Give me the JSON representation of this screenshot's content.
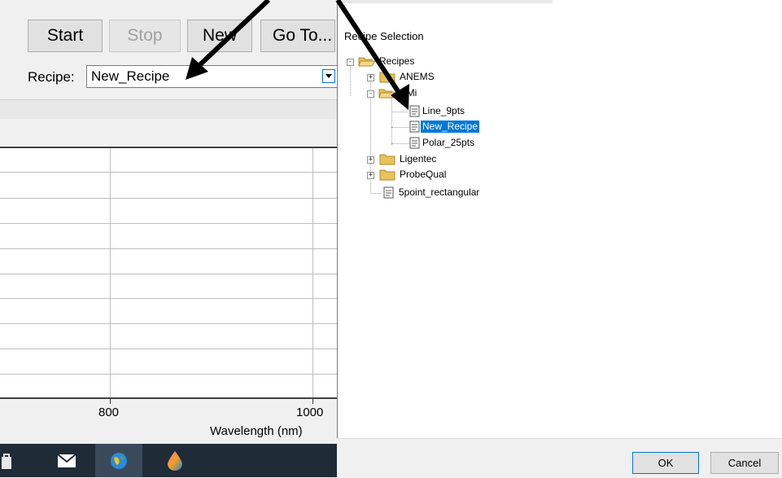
{
  "toolbar": {
    "start_label": "Start",
    "stop_label": "Stop",
    "new_label": "New",
    "goto_label": "Go To..."
  },
  "recipe": {
    "label": "Recipe:",
    "value": "New_Recipe"
  },
  "plot": {
    "x_ticks": [
      "800",
      "1000"
    ],
    "x_label": "Wavelength (nm)"
  },
  "taskbar": {
    "icons": [
      "shopping-bag-icon",
      "mail-icon",
      "globe-app-icon",
      "water-drop-icon"
    ]
  },
  "dialog": {
    "title": "Recipe Selection",
    "tree": {
      "root": "Recipes",
      "items": {
        "anems": "ANEMS",
        "cmi": "CMi",
        "line_9pts": "Line_9pts",
        "new_recipe": "New_Recipe",
        "polar_25pts": "Polar_25pts",
        "ligentec": "Ligentec",
        "probequal": "ProbeQual",
        "rect": "5point_rectangular"
      },
      "selected": "New_Recipe"
    },
    "ok_label": "OK",
    "cancel_label": "Cancel"
  },
  "colors": {
    "selection": "#0078d7",
    "folder": "#e8c25a",
    "taskbar": "#1f2b37"
  }
}
